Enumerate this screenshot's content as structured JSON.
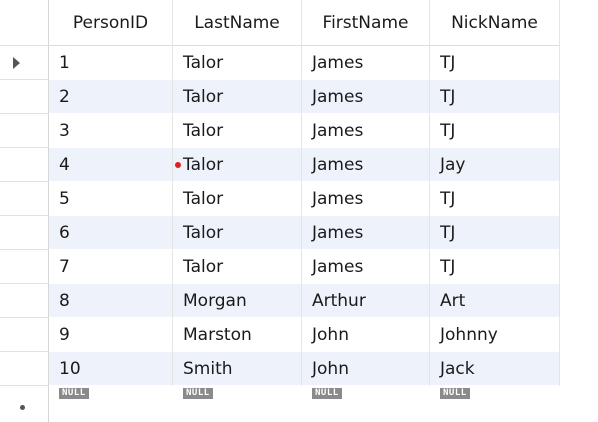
{
  "columns": [
    "PersonID",
    "LastName",
    "FirstName",
    "NickName"
  ],
  "rows": [
    [
      "1",
      "Talor",
      "James",
      "TJ"
    ],
    [
      "2",
      "Talor",
      "James",
      "TJ"
    ],
    [
      "3",
      "Talor",
      "James",
      "TJ"
    ],
    [
      "4",
      "Talor",
      "James",
      "Jay"
    ],
    [
      "5",
      "Talor",
      "James",
      "TJ"
    ],
    [
      "6",
      "Talor",
      "James",
      "TJ"
    ],
    [
      "7",
      "Talor",
      "James",
      "TJ"
    ],
    [
      "8",
      "Morgan",
      "Arthur",
      "Art"
    ],
    [
      "9",
      "Marston",
      "John",
      "Johnny"
    ],
    [
      "10",
      "Smith",
      "John",
      "Jack"
    ]
  ],
  "new_row": [
    "NULL",
    "NULL",
    "NULL",
    "NULL"
  ],
  "current_row_marker_icon": "current-row-arrow-icon",
  "new_row_marker_icon": "new-row-dot-icon",
  "edit_indicator_icon": "edited-cell-dot-icon",
  "colors": {
    "alt_row_background": "#eef3fb",
    "null_badge_background": "#8a8a8a",
    "edit_indicator": "#e02020"
  }
}
